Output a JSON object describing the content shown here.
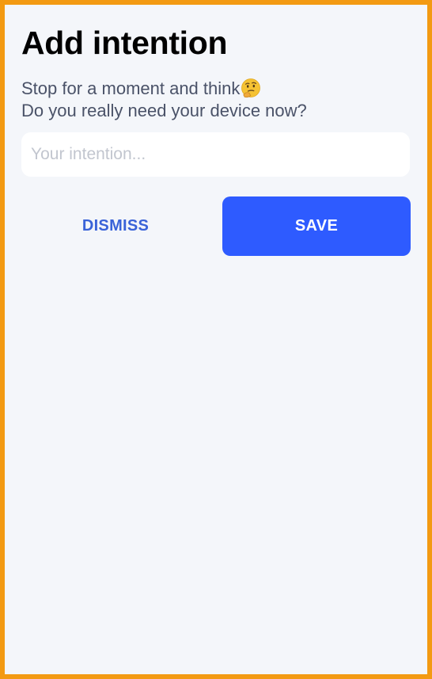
{
  "dialog": {
    "title": "Add intention",
    "subtitle_line1": "Stop for a moment and think",
    "subtitle_emoji": "thinking-face",
    "subtitle_line2": "Do you really need your device now?"
  },
  "input": {
    "value": "",
    "placeholder": "Your intention..."
  },
  "actions": {
    "dismiss_label": "DISMISS",
    "save_label": "SAVE"
  },
  "colors": {
    "frame_border": "#f39a12",
    "background": "#f4f6fa",
    "accent": "#2e5bff",
    "dismiss_text": "#3a63d8",
    "subtitle_text": "#4a5268"
  }
}
